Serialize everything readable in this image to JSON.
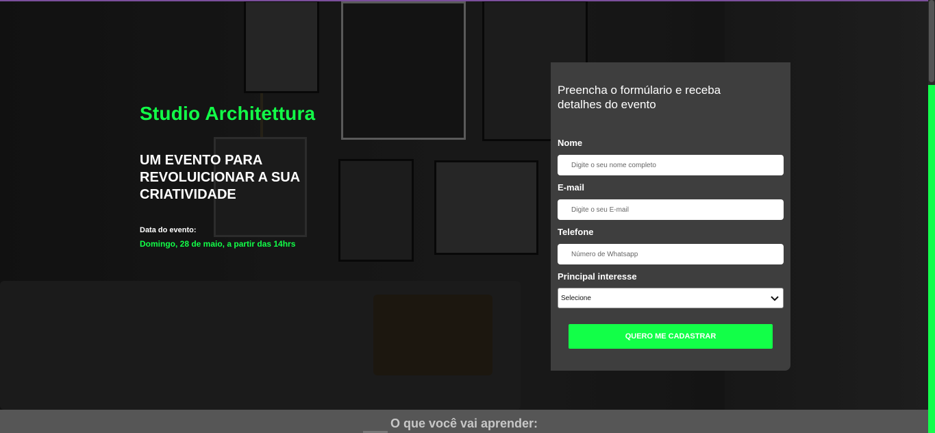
{
  "hero": {
    "brand": "Studio Architettura",
    "headline": "UM EVENTO PARA REVOLUICIONAR A SUA CRIATIVIDADE",
    "date_label": "Data do evento:",
    "date_value": "Domingo, 28 de maio, a partir das 14hrs"
  },
  "form": {
    "title": "Preencha o formúlario e receba detalhes do evento",
    "name_label": "Nome",
    "name_placeholder": "Digite o seu nome completo",
    "email_label": "E-mail",
    "email_placeholder": "Digite o seu E-mail",
    "phone_label": "Telefone",
    "phone_placeholder": "Número de Whatsapp",
    "interest_label": "Principal interesse",
    "interest_selected": "Selecione",
    "submit_label": "QUERO ME CADASTRAR"
  },
  "learn": {
    "title": "O que você vai aprender:"
  },
  "colors": {
    "accent": "#12ff48",
    "card": "#3e3e3e",
    "text": "#ffffff"
  },
  "icons": {
    "select_chevron": "chevron-down-icon"
  }
}
